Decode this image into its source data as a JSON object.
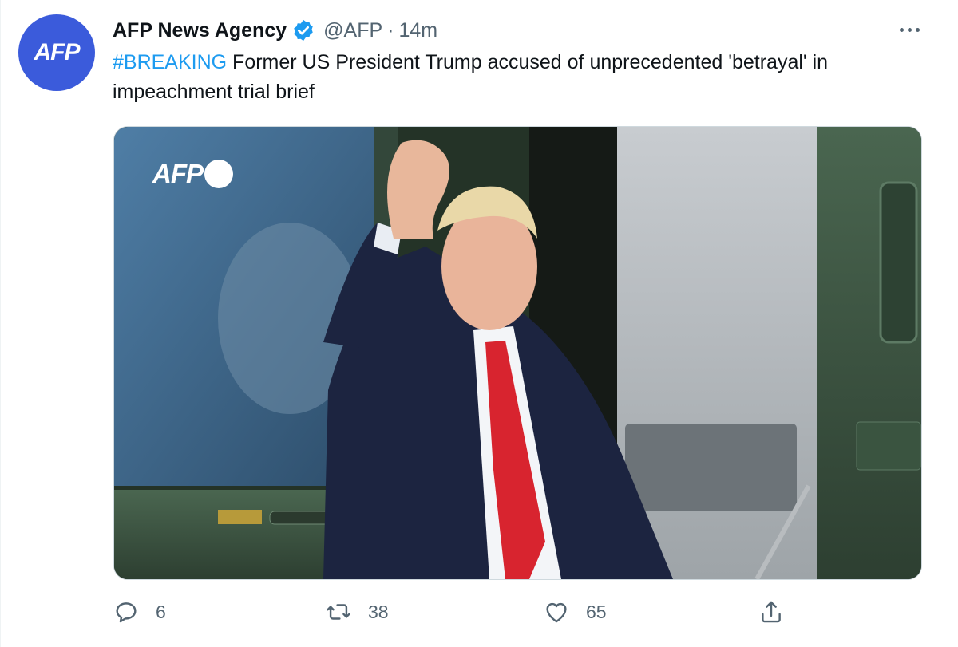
{
  "account": {
    "avatar_text": "AFP",
    "name": "AFP News Agency",
    "handle": "@AFP",
    "separator": "·",
    "time": "14m",
    "verified": true
  },
  "tweet": {
    "hashtag": "#BREAKING",
    "body": " Former US President Trump accused of unprecedented 'betrayal' in impeachment trial brief"
  },
  "media": {
    "watermark": "AFP",
    "panel_text": ""
  },
  "actions": {
    "reply_count": "6",
    "retweet_count": "38",
    "like_count": "65"
  },
  "colors": {
    "accent": "#1d9bf0",
    "avatar_bg": "#3b5bdb",
    "muted": "#536471",
    "tie": "#d8242f",
    "suit": "#1c2440",
    "helicopter": "#3d5a44"
  },
  "icons": [
    "more-icon",
    "verified-badge-icon",
    "reply-icon",
    "retweet-icon",
    "like-icon",
    "share-icon"
  ]
}
